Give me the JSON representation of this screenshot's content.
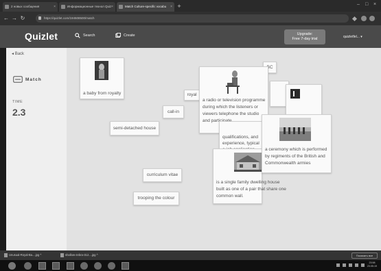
{
  "browser": {
    "tabs": [
      {
        "label": "2 новых сообщения",
        "active": false
      },
      {
        "label": "Информационные технол Quiz",
        "active": false
      },
      {
        "label": "Match Culture-specific vocabu",
        "active": true
      }
    ],
    "url": "https://quizlet.com/194508500/match"
  },
  "header": {
    "logo": "Quizlet",
    "search_label": "Search",
    "create_label": "Create",
    "upgrade_line1": "Upgrade:",
    "upgrade_line2": "Free 7-day trial",
    "username": "quizletfel... ▾"
  },
  "sidebar": {
    "back_label": "Back",
    "mode_label": "Match",
    "time_label": "TIME",
    "time_value": "2.3"
  },
  "cards": {
    "baby": "a baby from royalty",
    "royal": "royal",
    "bbc": "BC",
    "callin_def": "a radio or television programme during which the listeners or viewers telephone the studio and participate",
    "callin": "call-in",
    "semi": "semi-detached house",
    "cv_def_line1": "qualifications, and",
    "cv_def_line2": "experience, typical",
    "cv_def_line3": "a job application",
    "trooping_def": "a ceremony which is performed by regiments of the British and Commonwealth armies",
    "semi_def": "is a single family dwelling house built as one of a pair that share one common wall.",
    "cv": "curriculum vitae",
    "trooping": "trooping the colour"
  },
  "downloads": {
    "file1": "Unusual-Royal-Ba....jpg",
    "file2": "shallow-zebra-312....jpg",
    "show_all": "Показать все"
  },
  "taskbar": {
    "time": "23:58",
    "date": "23.05.19"
  },
  "colors": {
    "header_bg": "#4a4a4a",
    "board_bg": "#e2e2e2",
    "card_bg": "#fafafa",
    "upgrade_bg": "#7a7a7a"
  }
}
